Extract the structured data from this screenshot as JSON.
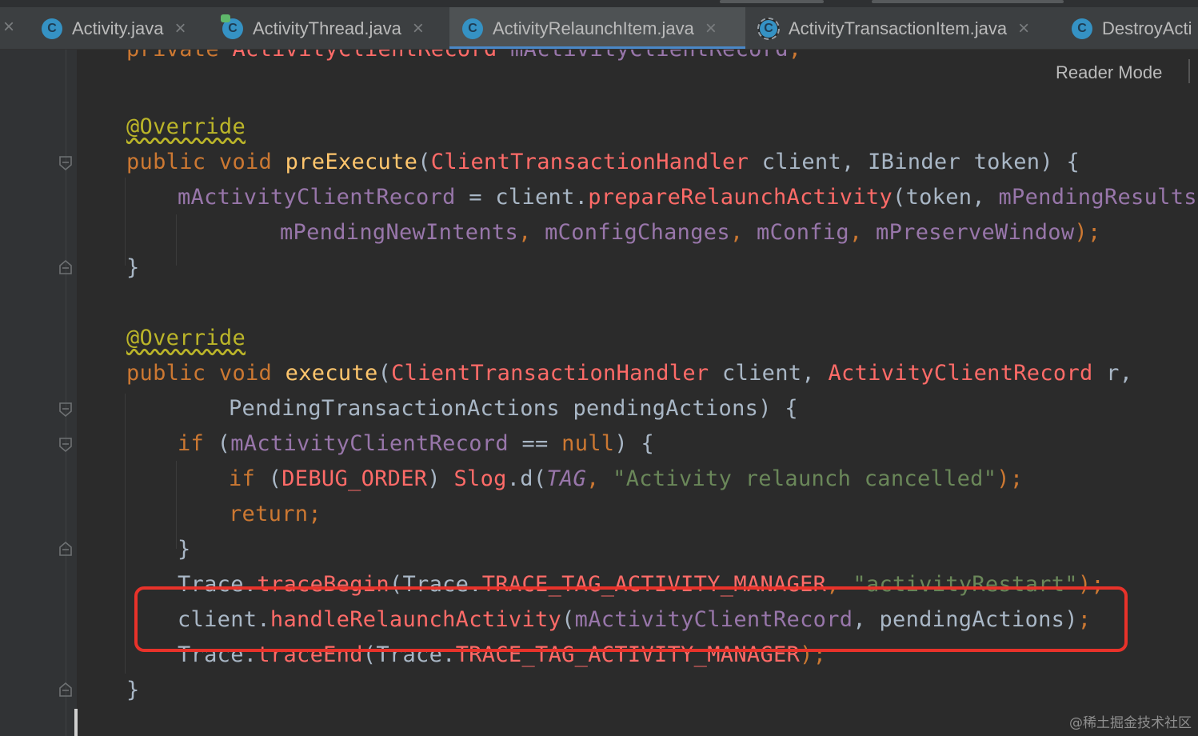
{
  "tabs": [
    {
      "label": "Activity.java",
      "icon": "class-icon",
      "active": false
    },
    {
      "label": "ActivityThread.java",
      "icon": "class-modified-icon",
      "active": false
    },
    {
      "label": "ActivityRelaunchItem.java",
      "icon": "class-icon",
      "active": true
    },
    {
      "label": "ActivityTransactionItem.java",
      "icon": "abstract-class-icon",
      "active": false
    },
    {
      "label": "DestroyActi",
      "icon": "class-icon",
      "active": false
    }
  ],
  "tab_icon_letter": "C",
  "close_glyph": "×",
  "reader_mode_label": "Reader Mode",
  "watermark": "@稀土掘金技术社区",
  "colors": {
    "keyword": "#cc7832",
    "annotation": "#bbb529",
    "method_decl": "#ffc66d",
    "field": "#9876aa",
    "call": "#ff6b68",
    "string": "#6a8759",
    "text": "#a9b7c6",
    "highlight_box": "#e8322a",
    "tab_accent": "#4a88c7"
  },
  "code": {
    "l0": [
      "private ",
      "ActivityClientRecord ",
      "mActivityClientRecord",
      ";"
    ],
    "l2": [
      "@Override"
    ],
    "l3": [
      "public void ",
      "preExecute",
      "(",
      "ClientTransactionHandler ",
      "client, IBinder token) {"
    ],
    "l4": [
      "mActivityClientRecord",
      " = client.",
      "prepareRelaunchActivity",
      "(token, ",
      "mPendingResults",
      ","
    ],
    "l5": [
      "mPendingNewIntents",
      ", ",
      "mConfigChanges",
      ", ",
      "mConfig",
      ", ",
      "mPreserveWindow",
      ");"
    ],
    "l6": [
      "}"
    ],
    "l8": [
      "@Override"
    ],
    "l9": [
      "public void ",
      "execute",
      "(",
      "ClientTransactionHandler ",
      "client, ",
      "ActivityClientRecord ",
      "r,"
    ],
    "l10": [
      "PendingTransactionActions pendingActions) {"
    ],
    "l11": [
      "if ",
      "(",
      "mActivityClientRecord",
      " == ",
      "null",
      ") {"
    ],
    "l12": [
      "if ",
      "(",
      "DEBUG_ORDER",
      ") ",
      "Slog",
      ".d(",
      "TAG",
      ", ",
      "\"Activity relaunch cancelled\"",
      ");"
    ],
    "l13": [
      "return;"
    ],
    "l14": [
      "}"
    ],
    "l15": [
      "Trace.",
      "traceBegin",
      "(Trace.",
      "TRACE_TAG_ACTIVITY_MANAGER",
      ", ",
      "\"activityRestart\"",
      ");"
    ],
    "l16": [
      "client.",
      "handleRelaunchActivity",
      "(",
      "mActivityClientRecord",
      ", pendingActions)",
      ";"
    ],
    "l17": [
      "Trace.",
      "traceEnd",
      "(Trace.",
      "TRACE_TAG_ACTIVITY_MANAGER",
      ");"
    ],
    "l18": [
      "}"
    ]
  }
}
